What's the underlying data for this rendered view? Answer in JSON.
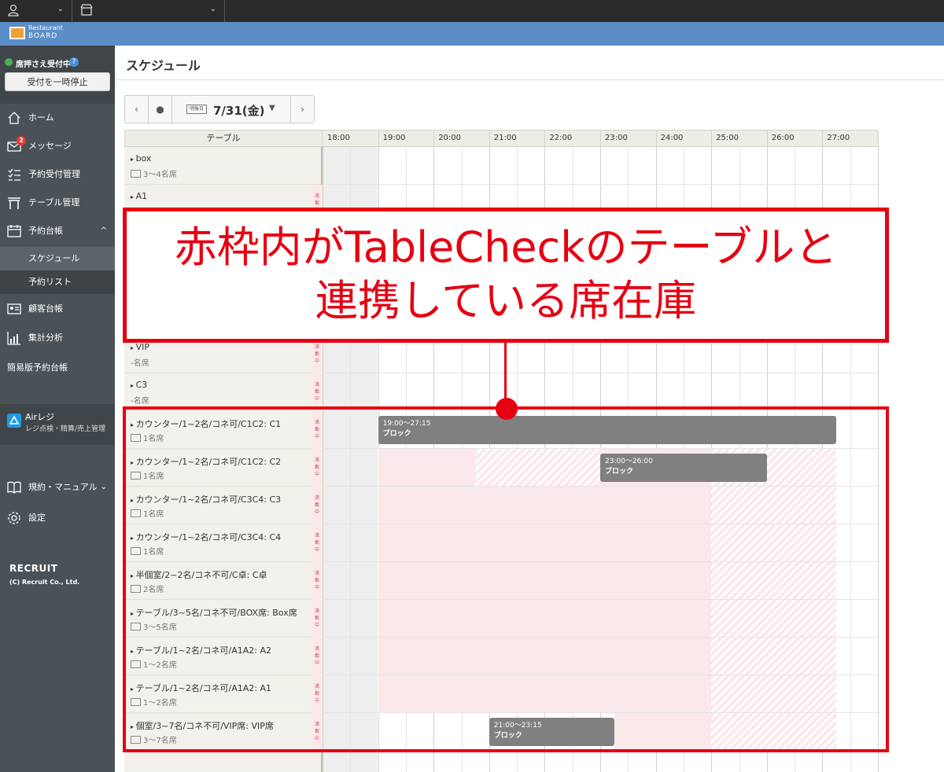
{
  "topbar": {
    "user_chevron": "⌄",
    "store_chevron": "⌄"
  },
  "brand": {
    "line1": "Restaurant",
    "line2": "BOARD"
  },
  "sidebar": {
    "status_label": "席押さえ受付中",
    "help": "?",
    "pause_button": "受付を一時停止",
    "items": [
      {
        "label": "ホーム",
        "icon": "home-icon"
      },
      {
        "label": "メッセージ",
        "icon": "mail-icon",
        "badge": "2"
      },
      {
        "label": "予約受付管理",
        "icon": "list-icon"
      },
      {
        "label": "テーブル管理",
        "icon": "table-icon"
      },
      {
        "label": "予約台帳",
        "icon": "calendar-icon",
        "chevron": "^"
      },
      {
        "label": "顧客台帳",
        "icon": "customer-card-icon"
      },
      {
        "label": "集計分析",
        "icon": "analytics-icon"
      },
      {
        "label": "簡易版予約台帳"
      },
      {
        "label": "規約・マニュアル",
        "icon": "book-icon",
        "chevron": "⌄"
      },
      {
        "label": "設定",
        "icon": "gear-icon"
      }
    ],
    "subitems": [
      {
        "label": "スケジュール",
        "active": true
      },
      {
        "label": "予約リスト",
        "active": false
      }
    ],
    "air": {
      "title": "Airレジ",
      "subtitle": "レジ点検・精算/売上管理"
    },
    "recruit": "RECRUIT",
    "copyright": "(C) Recruit Co., Ltd."
  },
  "page": {
    "title": "スケジュール"
  },
  "datenav": {
    "prev": "‹",
    "today": "●",
    "badge": "明後日",
    "date": "7/31(金)",
    "caret": "▼",
    "next": "›"
  },
  "grid": {
    "header_table": "テーブル",
    "hours": [
      "18:00",
      "19:00",
      "20:00",
      "21:00",
      "22:00",
      "23:00",
      "24:00",
      "25:00",
      "26:00",
      "27:00"
    ],
    "tag_chars": [
      "満",
      "載",
      "中"
    ],
    "rows": [
      {
        "name": "box",
        "capacity": "3〜4名席",
        "tag": false
      },
      {
        "name": "A1",
        "capacity": "",
        "tag": true
      },
      {
        "name": "",
        "capacity": "",
        "tag": true
      },
      {
        "name": "",
        "capacity": "",
        "tag": true
      },
      {
        "name": "",
        "capacity": "",
        "tag": true
      },
      {
        "name": "VIP",
        "capacity": "-名席",
        "tag": true
      },
      {
        "name": "C3",
        "capacity": "-名席",
        "tag": true
      },
      {
        "name": "カウンター/1~2名/コネ可/C1C2: C1",
        "capacity": "1名席",
        "tag": true
      },
      {
        "name": "カウンター/1~2名/コネ可/C1C2: C2",
        "capacity": "1名席",
        "tag": true
      },
      {
        "name": "カウンター/1~2名/コネ可/C3C4: C3",
        "capacity": "1名席",
        "tag": true
      },
      {
        "name": "カウンター/1~2名/コネ可/C3C4: C4",
        "capacity": "1名席",
        "tag": true
      },
      {
        "name": "半個室/2~2名/コネ不可/C卓: C卓",
        "capacity": "2名席",
        "tag": true
      },
      {
        "name": "テーブル/3~5名/コネ不可/BOX席: Box席",
        "capacity": "3〜5名席",
        "tag": true
      },
      {
        "name": "テーブル/1~2名/コネ可/A1A2: A2",
        "capacity": "1〜2名席",
        "tag": true
      },
      {
        "name": "テーブル/1~2名/コネ可/A1A2: A1",
        "capacity": "1〜2名席",
        "tag": true
      },
      {
        "name": "個室/3~7名/コネ不可/VIP席: VIP席",
        "capacity": "3〜7名席",
        "tag": true
      }
    ],
    "blocks": [
      {
        "row": 7,
        "start": "19:00",
        "end": "27:15",
        "time": "19:00〜27:15",
        "label": "ブロック"
      },
      {
        "row": 8,
        "start": "23:00",
        "end": "26:00",
        "time": "23:00〜26:00",
        "label": "ブロック"
      },
      {
        "row": 15,
        "start": "21:00",
        "end": "23:15",
        "time": "21:00〜23:15",
        "label": "ブロック"
      }
    ]
  },
  "annotation": {
    "line1": "赤枠内がTableCheckのテーブルと",
    "line2": "連携している席在庫",
    "color": "#e60012"
  }
}
